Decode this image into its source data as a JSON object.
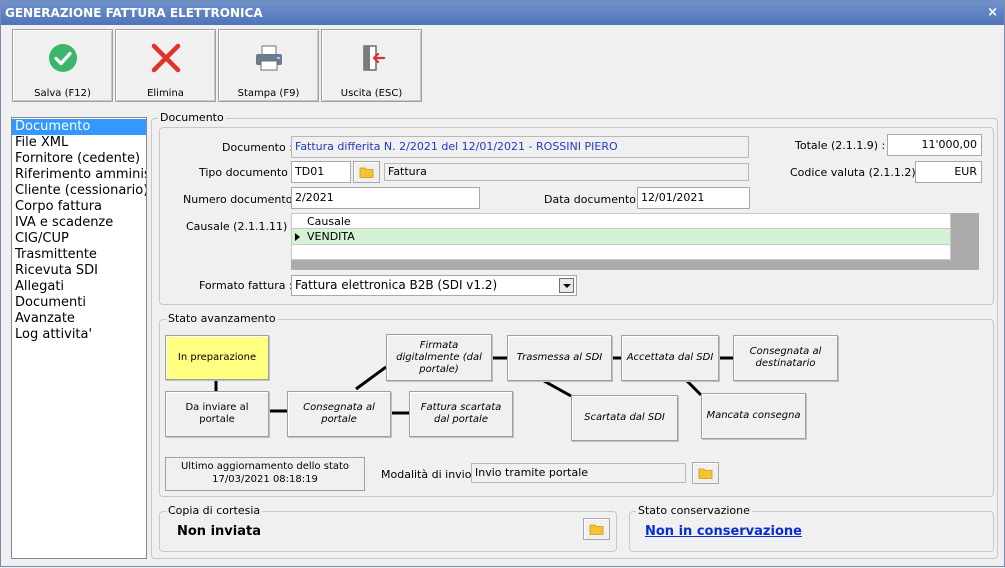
{
  "window": {
    "title": "GENERAZIONE FATTURA ELETTRONICA",
    "close_glyph": "×"
  },
  "toolbar": {
    "save_label": "Salva (F12)",
    "delete_label": "Elimina",
    "print_label": "Stampa (F9)",
    "exit_label": "Uscita (ESC)"
  },
  "sidebar": {
    "items": [
      {
        "label": "Documento"
      },
      {
        "label": "File XML"
      },
      {
        "label": "Fornitore (cedente)"
      },
      {
        "label": "Riferimento amministr"
      },
      {
        "label": "Cliente (cessionario)"
      },
      {
        "label": "Corpo fattura"
      },
      {
        "label": "IVA e scadenze"
      },
      {
        "label": "CIG/CUP"
      },
      {
        "label": "Trasmittente"
      },
      {
        "label": "Ricevuta SDI"
      },
      {
        "label": "Allegati"
      },
      {
        "label": "Documenti"
      },
      {
        "label": "Avanzate"
      },
      {
        "label": "Log attivita'"
      }
    ],
    "selected": "Documento"
  },
  "documento": {
    "group_label": "Documento",
    "documento_label": "Documento :",
    "documento_value": "Fattura differita N. 2/2021 del 12/01/2021 - ROSSINI PIERO",
    "tipo_label": "Tipo documento :",
    "tipo_code": "TD01",
    "tipo_desc": "Fattura",
    "numero_label": "Numero documento :",
    "numero_value": "2/2021",
    "data_label": "Data documento :",
    "data_value": "12/01/2021",
    "totale_label": "Totale (2.1.1.9) :",
    "totale_value": "11'000,00",
    "valuta_label": "Codice valuta (2.1.1.2) :",
    "valuta_value": "EUR",
    "causale_label": "Causale (2.1.1.11) :",
    "causale_header": "Causale",
    "causale_rows": [
      "VENDITA"
    ],
    "formato_label": "Formato fattura :",
    "formato_value": "Fattura elettronica B2B (SDI v1.2)"
  },
  "stato": {
    "group_label": "Stato avanzamento",
    "states": {
      "in_preparazione": "In preparazione",
      "da_inviare": "Da inviare al portale",
      "consegnata_portale": "Consegnata al portale",
      "firmata": "Firmata digitalmente (dal portale)",
      "scartata_portale": "Fattura scartata dal portale",
      "trasmessa": "Trasmessa al SDI",
      "scartata_sdi": "Scartata dal SDI",
      "accettata": "Accettata dal SDI",
      "mancata": "Mancata consegna",
      "consegnata_dest": "Consegnata al destinatario"
    },
    "active_state": "In preparazione",
    "active_color": "#ffff80",
    "ultimo_agg_label": "Ultimo aggiornamento dello stato",
    "ultimo_agg_value": "17/03/2021 08:18:19",
    "modalita_label": "Modalità di invio :",
    "modalita_value": "Invio tramite portale"
  },
  "copia": {
    "group_label": "Copia di cortesia",
    "value": "Non inviata"
  },
  "conservazione": {
    "group_label": "Stato conservazione",
    "link": "Non in conservazione"
  }
}
